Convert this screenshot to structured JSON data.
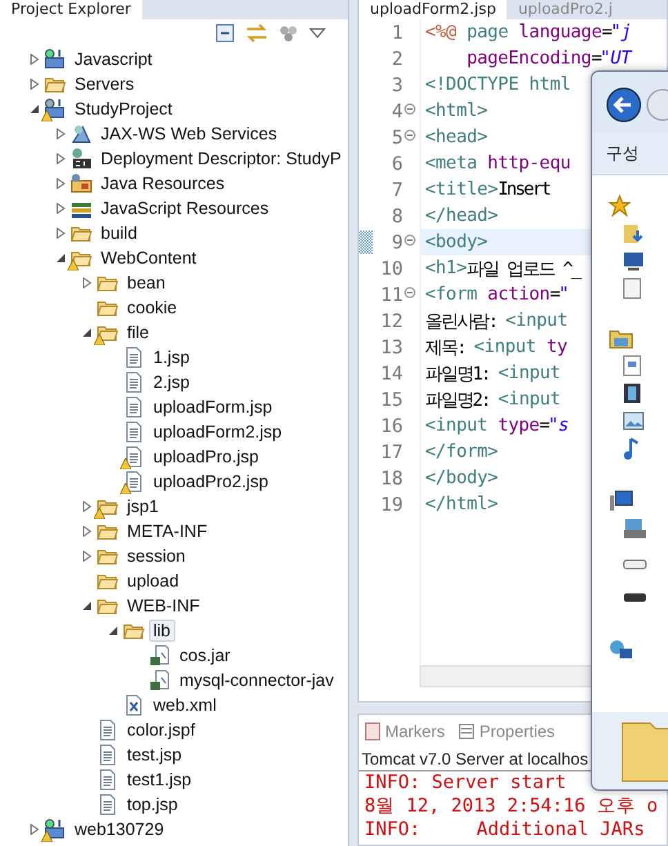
{
  "explorer": {
    "tab_label": "Project Explorer",
    "tree": [
      {
        "label": "Javascript",
        "kind": "js-project",
        "warning": false,
        "expanded": false,
        "selected": false
      },
      {
        "label": "Servers",
        "kind": "folder",
        "warning": false,
        "expanded": false,
        "selected": false
      },
      {
        "label": "StudyProject",
        "kind": "project",
        "warning": true,
        "expanded": true,
        "selected": false,
        "children": [
          {
            "label": "JAX-WS Web Services",
            "kind": "service",
            "warning": false,
            "expanded": false,
            "selected": false
          },
          {
            "label": "Deployment Descriptor: StudyP",
            "kind": "descriptor",
            "warning": false,
            "expanded": false,
            "selected": false
          },
          {
            "label": "Java Resources",
            "kind": "java-res",
            "warning": false,
            "expanded": false,
            "selected": false
          },
          {
            "label": "JavaScript Resources",
            "kind": "books",
            "warning": false,
            "expanded": false,
            "selected": false
          },
          {
            "label": "build",
            "kind": "folder",
            "warning": false,
            "expanded": false,
            "selected": false
          },
          {
            "label": "WebContent",
            "kind": "folder",
            "warning": true,
            "expanded": true,
            "selected": false,
            "children": [
              {
                "label": "bean",
                "kind": "folder",
                "warning": false,
                "expanded": false,
                "selected": false
              },
              {
                "label": "cookie",
                "kind": "folder",
                "warning": false,
                "selected": false
              },
              {
                "label": "file",
                "kind": "folder",
                "warning": true,
                "expanded": true,
                "selected": false,
                "children": [
                  {
                    "label": "1.jsp",
                    "kind": "file",
                    "warning": false,
                    "selected": false
                  },
                  {
                    "label": "2.jsp",
                    "kind": "file",
                    "warning": false,
                    "selected": false
                  },
                  {
                    "label": "uploadForm.jsp",
                    "kind": "file",
                    "warning": false,
                    "selected": false
                  },
                  {
                    "label": "uploadForm2.jsp",
                    "kind": "file",
                    "warning": false,
                    "selected": false
                  },
                  {
                    "label": "uploadPro.jsp",
                    "kind": "file",
                    "warning": true,
                    "selected": false
                  },
                  {
                    "label": "uploadPro2.jsp",
                    "kind": "file",
                    "warning": true,
                    "selected": false
                  }
                ]
              },
              {
                "label": "jsp1",
                "kind": "folder",
                "warning": true,
                "expanded": false,
                "selected": false
              },
              {
                "label": "META-INF",
                "kind": "folder",
                "warning": false,
                "expanded": false,
                "selected": false
              },
              {
                "label": "session",
                "kind": "folder",
                "warning": false,
                "expanded": false,
                "selected": false
              },
              {
                "label": "upload",
                "kind": "folder",
                "warning": false,
                "selected": false
              },
              {
                "label": "WEB-INF",
                "kind": "folder",
                "warning": false,
                "expanded": true,
                "selected": false,
                "children": [
                  {
                    "label": "lib",
                    "kind": "folder",
                    "warning": false,
                    "expanded": true,
                    "selected": true,
                    "children": [
                      {
                        "label": "cos.jar",
                        "kind": "jar",
                        "warning": false,
                        "selected": false
                      },
                      {
                        "label": "mysql-connector-jav",
                        "kind": "jar",
                        "warning": false,
                        "selected": false
                      }
                    ]
                  },
                  {
                    "label": "web.xml",
                    "kind": "xml",
                    "warning": false,
                    "selected": false
                  }
                ]
              },
              {
                "label": "color.jspf",
                "kind": "file",
                "warning": false,
                "selected": false
              },
              {
                "label": "test.jsp",
                "kind": "file",
                "warning": false,
                "selected": false
              },
              {
                "label": "test1.jsp",
                "kind": "file",
                "warning": false,
                "selected": false
              },
              {
                "label": "top.jsp",
                "kind": "file",
                "warning": false,
                "selected": false
              }
            ]
          }
        ]
      },
      {
        "label": "web130729",
        "kind": "js-project",
        "warning": true,
        "expanded": false,
        "selected": false
      }
    ]
  },
  "editor": {
    "tabs": [
      {
        "label": "uploadForm2.jsp",
        "selected": true
      },
      {
        "label": "uploadPro2.j",
        "selected": false
      }
    ],
    "lines": [
      {
        "number": "1",
        "fold": false,
        "current": false,
        "tokens": [
          {
            "kind": "directive",
            "text": "<%@"
          },
          {
            "kind": "tag",
            "text": " page "
          },
          {
            "kind": "attr",
            "text": "language"
          },
          {
            "kind": "text",
            "text": "="
          },
          {
            "kind": "string",
            "text": "\"j"
          }
        ]
      },
      {
        "number": "2",
        "fold": false,
        "current": false,
        "tokens": [
          {
            "kind": "attr",
            "text": "    pageEncoding"
          },
          {
            "kind": "text",
            "text": "="
          },
          {
            "kind": "string",
            "text": "\"UT"
          }
        ]
      },
      {
        "number": "3",
        "fold": false,
        "current": false,
        "tokens": [
          {
            "kind": "tag",
            "text": "<!DOCTYPE html"
          }
        ]
      },
      {
        "number": "4",
        "fold": true,
        "current": false,
        "tokens": [
          {
            "kind": "tag",
            "text": "<html>"
          }
        ]
      },
      {
        "number": "5",
        "fold": true,
        "current": false,
        "tokens": [
          {
            "kind": "tag",
            "text": "<head>"
          }
        ]
      },
      {
        "number": "6",
        "fold": false,
        "current": false,
        "tokens": [
          {
            "kind": "tag",
            "text": "<meta "
          },
          {
            "kind": "attr",
            "text": "http-equ"
          }
        ]
      },
      {
        "number": "7",
        "fold": false,
        "current": false,
        "tokens": [
          {
            "kind": "tag",
            "text": "<title>"
          },
          {
            "kind": "text",
            "text": "Insert"
          }
        ]
      },
      {
        "number": "8",
        "fold": false,
        "current": false,
        "tokens": [
          {
            "kind": "tag",
            "text": "</head>"
          }
        ]
      },
      {
        "number": "9",
        "fold": true,
        "current": true,
        "tokens": [
          {
            "kind": "tag",
            "text": "<body>"
          }
        ]
      },
      {
        "number": "10",
        "fold": false,
        "current": false,
        "tokens": [
          {
            "kind": "tag",
            "text": "<h1>"
          },
          {
            "kind": "text",
            "text": "파일 업로드 ^_"
          }
        ]
      },
      {
        "number": "11",
        "fold": true,
        "current": false,
        "tokens": [
          {
            "kind": "tag",
            "text": "<form "
          },
          {
            "kind": "attr",
            "text": "action"
          },
          {
            "kind": "text",
            "text": "="
          },
          {
            "kind": "string",
            "text": "\""
          }
        ]
      },
      {
        "number": "12",
        "fold": false,
        "current": false,
        "tokens": [
          {
            "kind": "text",
            "text": "올린사람: "
          },
          {
            "kind": "tag",
            "text": "<input"
          }
        ]
      },
      {
        "number": "13",
        "fold": false,
        "current": false,
        "tokens": [
          {
            "kind": "text",
            "text": "제목: "
          },
          {
            "kind": "tag",
            "text": "<input "
          },
          {
            "kind": "attr",
            "text": "ty"
          }
        ]
      },
      {
        "number": "14",
        "fold": false,
        "current": false,
        "tokens": [
          {
            "kind": "text",
            "text": "파일명1: "
          },
          {
            "kind": "tag",
            "text": "<input"
          }
        ]
      },
      {
        "number": "15",
        "fold": false,
        "current": false,
        "tokens": [
          {
            "kind": "text",
            "text": "파일명2: "
          },
          {
            "kind": "tag",
            "text": "<input"
          }
        ]
      },
      {
        "number": "16",
        "fold": false,
        "current": false,
        "tokens": [
          {
            "kind": "tag",
            "text": "<input "
          },
          {
            "kind": "attr",
            "text": "type"
          },
          {
            "kind": "text",
            "text": "="
          },
          {
            "kind": "string",
            "text": "\"s"
          }
        ]
      },
      {
        "number": "17",
        "fold": false,
        "current": false,
        "tokens": [
          {
            "kind": "tag",
            "text": "</form>"
          }
        ]
      },
      {
        "number": "18",
        "fold": false,
        "current": false,
        "tokens": [
          {
            "kind": "tag",
            "text": "</body>"
          }
        ]
      },
      {
        "number": "19",
        "fold": false,
        "current": false,
        "tokens": [
          {
            "kind": "tag",
            "text": "</html>"
          }
        ]
      }
    ]
  },
  "console": {
    "tabs": [
      {
        "label": "Markers",
        "kind": "markers"
      },
      {
        "label": "Properties",
        "kind": "properties"
      }
    ],
    "title": "Tomcat v7.0 Server at localhos",
    "lines": [
      "INFO: Server start",
      "8월 12, 2013 2:54:16 오후 o",
      "INFO:     Additional JARs"
    ]
  },
  "dialog": {
    "toolbar_label": "구성"
  }
}
